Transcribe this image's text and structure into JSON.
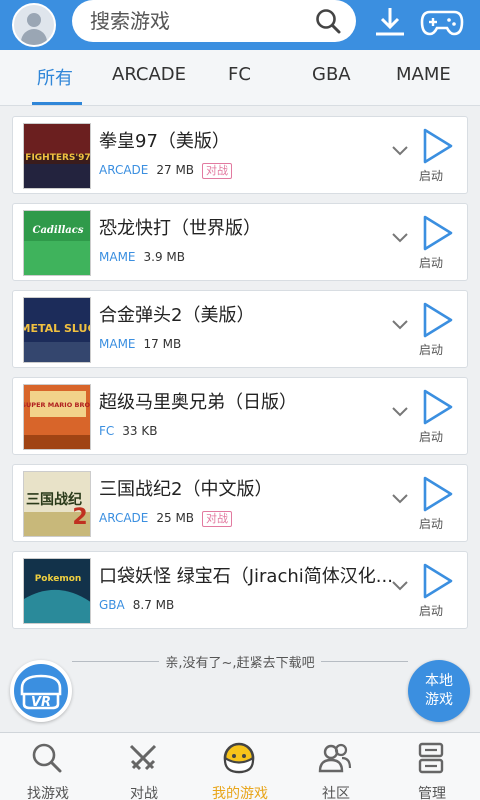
{
  "header": {
    "search_placeholder": "搜索游戏"
  },
  "tabs": [
    "所有",
    "ARCADE",
    "FC",
    "GBA",
    "MAME"
  ],
  "games": [
    {
      "title": "拳皇97（美版）",
      "platform": "ARCADE",
      "size": "27 MB",
      "badge": "对战",
      "thumb_label": "FIGHTERS'97"
    },
    {
      "title": "恐龙快打（世界版）",
      "platform": "MAME",
      "size": "3.9 MB",
      "badge": "",
      "thumb_label": "Cadillacs"
    },
    {
      "title": "合金弹头2（美版）",
      "platform": "MAME",
      "size": "17 MB",
      "badge": "",
      "thumb_label": "METAL SLUG"
    },
    {
      "title": "超级马里奥兄弟（日版）",
      "platform": "FC",
      "size": "33 KB",
      "badge": "",
      "thumb_label": "SUPER MARIO BROS"
    },
    {
      "title": "三国战纪2（中文版）",
      "platform": "ARCADE",
      "size": "25 MB",
      "badge": "对战",
      "thumb_label": "三国战纪"
    },
    {
      "title": "口袋妖怪 绿宝石（Jirachi简体汉化...",
      "platform": "GBA",
      "size": "8.7 MB",
      "badge": "",
      "thumb_label": "Pokemon"
    }
  ],
  "start_label": "启动",
  "end_text": "亲,没有了~,赶紧去下载吧",
  "vr_label": "VR",
  "local_games": {
    "line1": "本地",
    "line2": "游戏"
  },
  "bottom_nav": [
    "找游戏",
    "对战",
    "我的游戏",
    "社区",
    "管理"
  ],
  "colors": {
    "primary": "#3b8fe0",
    "badge": "#e27aa0",
    "active_nav": "#e8a51a"
  }
}
